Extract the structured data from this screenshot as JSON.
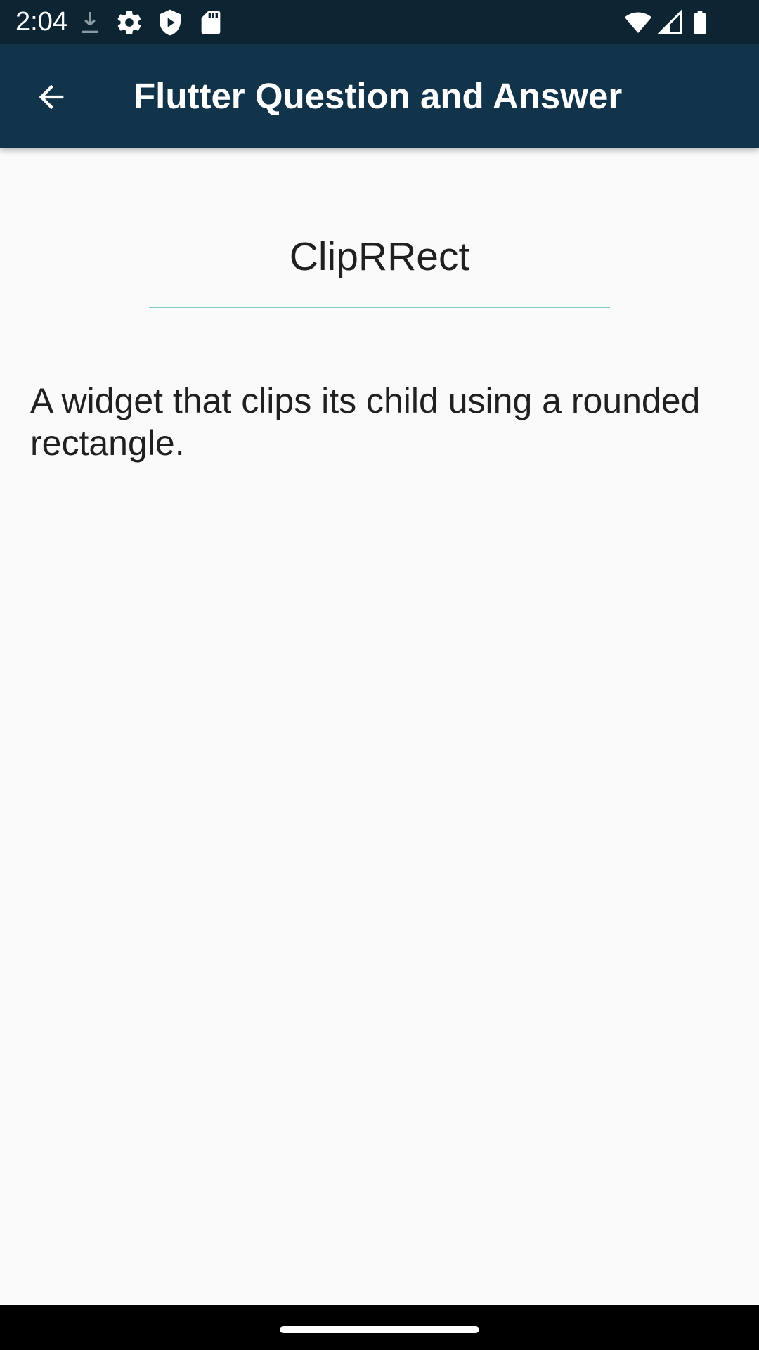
{
  "status_bar": {
    "time": "2:04",
    "icons": [
      "download-icon",
      "settings-gear-icon",
      "shield-play-icon",
      "sd-card-icon",
      "wifi-icon",
      "cell-signal-icon",
      "battery-icon"
    ]
  },
  "app_bar": {
    "back_icon": "arrow-back-icon",
    "title": "Flutter Question and Answer",
    "background_color": "#12344a"
  },
  "content": {
    "question": "ClipRRect",
    "answer": "A widget that clips its child using a rounded rectangle.",
    "divider_color": "#80cbc4"
  },
  "nav_bar": {
    "home_handle": "home-gesture-handle"
  }
}
